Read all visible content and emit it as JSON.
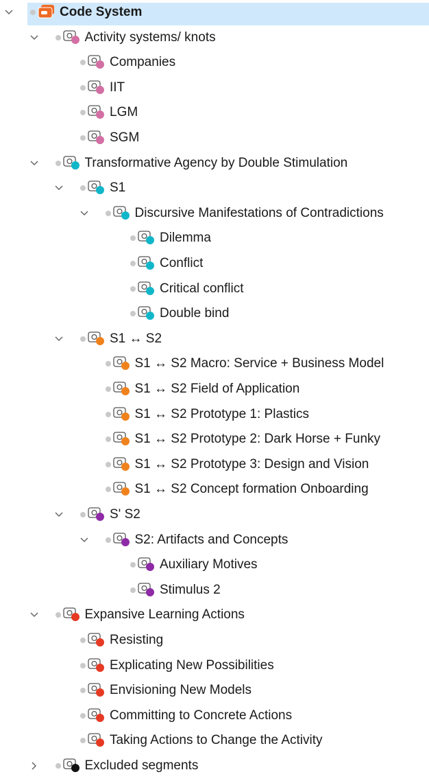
{
  "tree": {
    "items": [
      {
        "id": "root",
        "label": "Code System",
        "depth": 0,
        "expand": "expanded",
        "color": "#ee6a24",
        "root": true,
        "icon": "code-system-icon"
      },
      {
        "id": "activity-systems",
        "label": "Activity systems/ knots",
        "depth": 1,
        "expand": "expanded",
        "color": "#d36fa4",
        "icon": "code-icon"
      },
      {
        "id": "companies",
        "label": "Companies",
        "depth": 2,
        "expand": "leaf",
        "color": "#d36fa4",
        "icon": "code-icon"
      },
      {
        "id": "iit",
        "label": "IIT",
        "depth": 2,
        "expand": "leaf",
        "color": "#d36fa4",
        "icon": "code-icon"
      },
      {
        "id": "lgm",
        "label": "LGM",
        "depth": 2,
        "expand": "leaf",
        "color": "#d36fa4",
        "icon": "code-icon"
      },
      {
        "id": "sgm",
        "label": "SGM",
        "depth": 2,
        "expand": "leaf",
        "color": "#d36fa4",
        "icon": "code-icon"
      },
      {
        "id": "tads",
        "label": "Transformative Agency by Double Stimulation",
        "depth": 1,
        "expand": "expanded",
        "color": "#12b6c9",
        "icon": "code-icon"
      },
      {
        "id": "s1",
        "label": "S1",
        "depth": 2,
        "expand": "expanded",
        "color": "#12b6c9",
        "icon": "code-icon"
      },
      {
        "id": "discursive",
        "label": "Discursive Manifestations of Contradictions",
        "depth": 3,
        "expand": "expanded",
        "color": "#12b6c9",
        "icon": "code-icon"
      },
      {
        "id": "dilemma",
        "label": "Dilemma",
        "depth": 4,
        "expand": "leaf",
        "color": "#12b6c9",
        "icon": "code-icon"
      },
      {
        "id": "conflict",
        "label": "Conflict",
        "depth": 4,
        "expand": "leaf",
        "color": "#12b6c9",
        "icon": "code-icon"
      },
      {
        "id": "critical-conflict",
        "label": "Critical conflict",
        "depth": 4,
        "expand": "leaf",
        "color": "#12b6c9",
        "icon": "code-icon"
      },
      {
        "id": "double-bind",
        "label": "Double bind",
        "depth": 4,
        "expand": "leaf",
        "color": "#12b6c9",
        "icon": "code-icon"
      },
      {
        "id": "s1-s2",
        "label": "S1 ↔ S2",
        "depth": 2,
        "expand": "expanded",
        "color": "#f0821e",
        "icon": "code-icon"
      },
      {
        "id": "s1s2-macro",
        "label": "S1 ↔ S2 Macro: Service + Business Model",
        "depth": 3,
        "expand": "leaf",
        "color": "#f0821e",
        "icon": "code-icon"
      },
      {
        "id": "s1s2-field",
        "label": "S1 ↔ S2 Field of Application",
        "depth": 3,
        "expand": "leaf",
        "color": "#f0821e",
        "icon": "code-icon"
      },
      {
        "id": "s1s2-proto1",
        "label": "S1 ↔ S2 Prototype 1: Plastics",
        "depth": 3,
        "expand": "leaf",
        "color": "#f0821e",
        "icon": "code-icon"
      },
      {
        "id": "s1s2-proto2",
        "label": "S1 ↔ S2 Prototype 2: Dark Horse + Funky",
        "depth": 3,
        "expand": "leaf",
        "color": "#f0821e",
        "icon": "code-icon"
      },
      {
        "id": "s1s2-proto3",
        "label": "S1 ↔ S2 Prototype 3: Design and Vision",
        "depth": 3,
        "expand": "leaf",
        "color": "#f0821e",
        "icon": "code-icon"
      },
      {
        "id": "s1s2-concept",
        "label": "S1 ↔ S2 Concept formation Onboarding",
        "depth": 3,
        "expand": "leaf",
        "color": "#f0821e",
        "icon": "code-icon"
      },
      {
        "id": "s-prime-s2",
        "label": "S' S2",
        "depth": 2,
        "expand": "expanded",
        "color": "#8e2aa6",
        "icon": "code-icon"
      },
      {
        "id": "s2-artifacts",
        "label": "S2: Artifacts and Concepts",
        "depth": 3,
        "expand": "expanded",
        "color": "#8e2aa6",
        "icon": "code-icon"
      },
      {
        "id": "aux-motives",
        "label": "Auxiliary Motives",
        "depth": 4,
        "expand": "leaf",
        "color": "#8e2aa6",
        "icon": "code-icon"
      },
      {
        "id": "stimulus-2",
        "label": "Stimulus 2",
        "depth": 4,
        "expand": "leaf",
        "color": "#8e2aa6",
        "icon": "code-icon"
      },
      {
        "id": "expansive",
        "label": "Expansive Learning Actions",
        "depth": 1,
        "expand": "expanded",
        "color": "#e63a24",
        "icon": "code-icon"
      },
      {
        "id": "resisting",
        "label": "Resisting",
        "depth": 2,
        "expand": "leaf",
        "color": "#e63a24",
        "icon": "code-icon"
      },
      {
        "id": "explicating",
        "label": "Explicating New Possibilities",
        "depth": 2,
        "expand": "leaf",
        "color": "#e63a24",
        "icon": "code-icon"
      },
      {
        "id": "envisioning",
        "label": "Envisioning New Models",
        "depth": 2,
        "expand": "leaf",
        "color": "#e63a24",
        "icon": "code-icon"
      },
      {
        "id": "committing",
        "label": "Committing to Concrete Actions",
        "depth": 2,
        "expand": "leaf",
        "color": "#e63a24",
        "icon": "code-icon"
      },
      {
        "id": "taking-actions",
        "label": "Taking Actions to Change the Activity",
        "depth": 2,
        "expand": "leaf",
        "color": "#e63a24",
        "icon": "code-icon"
      },
      {
        "id": "excluded",
        "label": "Excluded segments",
        "depth": 1,
        "expand": "collapsed",
        "color": "#111111",
        "icon": "code-icon"
      }
    ]
  }
}
